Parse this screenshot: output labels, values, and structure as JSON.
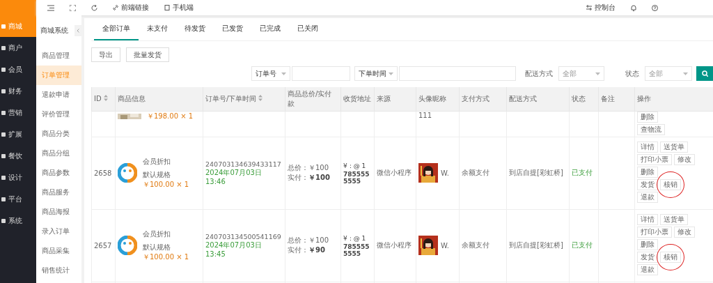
{
  "main_nav": [
    {
      "label": "商城",
      "selected": true
    },
    {
      "label": "商户",
      "selected": false
    },
    {
      "label": "会员",
      "selected": false
    },
    {
      "label": "财务",
      "selected": false
    },
    {
      "label": "营销",
      "selected": false
    },
    {
      "label": "扩展",
      "selected": false
    },
    {
      "label": "餐饮",
      "selected": false
    },
    {
      "label": "设计",
      "selected": false
    },
    {
      "label": "平台",
      "selected": false
    },
    {
      "label": "系统",
      "selected": false
    }
  ],
  "top_bar": {
    "links": [
      "前端链接",
      "手机端"
    ],
    "right": "控制台"
  },
  "sub_nav": {
    "title": "商城系统",
    "items": [
      {
        "label": "商品管理",
        "selected": false
      },
      {
        "label": "订单管理",
        "selected": true
      },
      {
        "label": "退款申请",
        "selected": false
      },
      {
        "label": "评价管理",
        "selected": false
      },
      {
        "label": "商品分类",
        "selected": false
      },
      {
        "label": "商品分组",
        "selected": false
      },
      {
        "label": "商品参数",
        "selected": false
      },
      {
        "label": "商品服务",
        "selected": false
      },
      {
        "label": "商品海报",
        "selected": false
      },
      {
        "label": "录入订单",
        "selected": false
      },
      {
        "label": "商品采集",
        "selected": false
      },
      {
        "label": "销售统计",
        "selected": false
      }
    ]
  },
  "tabs": [
    {
      "label": "全部订单",
      "selected": true
    },
    {
      "label": "未支付",
      "selected": false
    },
    {
      "label": "待发货",
      "selected": false
    },
    {
      "label": "已发货",
      "selected": false
    },
    {
      "label": "已完成",
      "selected": false
    },
    {
      "label": "已关闭",
      "selected": false
    }
  ],
  "actions": [
    "导出",
    "批量发货"
  ],
  "filters": {
    "search_type": "订单号",
    "time_type": "下单时间",
    "delivery_label": "配送方式",
    "delivery_placeholder": "全部",
    "status_label": "状态",
    "status_placeholder": "全部"
  },
  "table": {
    "columns": [
      "ID",
      "商品信息",
      "订单号/下单时间",
      "商品总价/实付款",
      "收货地址",
      "来源",
      "头像昵称",
      "支付方式",
      "配送方式",
      "状态",
      "备注",
      "操作"
    ],
    "partial_row": {
      "price": "￥198.00 × 1",
      "nickname": "111",
      "buttons": [
        "删除",
        "查物流"
      ]
    },
    "rows": [
      {
        "id": "2658",
        "product": "会员折扣",
        "spec": "默认规格",
        "price": "￥100.00 × 1",
        "order_no": "240703134639433117",
        "time": "2024年07月03日 13:46",
        "total": "总价：￥100",
        "paid_label": "实付：",
        "paid": "￥100",
        "address": [
          "¥：@ 1",
          "785555",
          "5555"
        ],
        "source": "微信小程序",
        "nickname": "W.",
        "payment": "余额支付",
        "delivery": "到店自提[彩虹桥]",
        "status": "已支付",
        "buttons": [
          [
            "详情",
            "送货单"
          ],
          [
            "打印小票",
            "修改"
          ],
          [
            "删除"
          ],
          [
            "发货",
            "核销"
          ],
          [
            "退款"
          ]
        ],
        "circled": true
      },
      {
        "id": "2657",
        "product": "会员折扣",
        "spec": "默认规格",
        "price": "￥100.00 × 1",
        "order_no": "240703134500541169",
        "time": "2024年07月03日 13:45",
        "total": "总价：￥100",
        "paid_label": "实付：",
        "paid": "￥90",
        "address": [
          "¥：@ 1",
          "785555",
          "5555"
        ],
        "source": "微信小程序",
        "nickname": "W.",
        "payment": "余额支付",
        "delivery": "到店自提[彩虹桥]",
        "status": "已支付",
        "buttons": [
          [
            "详情",
            "送货单"
          ],
          [
            "打印小票",
            "修改"
          ],
          [
            "删除"
          ],
          [
            "发货",
            "核销"
          ],
          [
            "退款"
          ]
        ],
        "circled": true
      }
    ]
  }
}
